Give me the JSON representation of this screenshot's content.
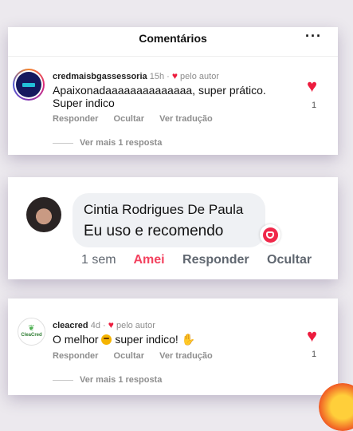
{
  "card1": {
    "title": "Comentários",
    "more_icon": "more-horizontal-icon",
    "username": "credmaisbgassessoria",
    "time": "15h",
    "separator": "·",
    "liked_by_author": "pelo autor",
    "text": "Apaixonadaaaaaaaaaaaaaa, super prático. Super indico",
    "actions": {
      "reply": "Responder",
      "hide": "Ocultar",
      "translate": "Ver tradução"
    },
    "like_count": "1",
    "view_replies": "Ver mais 1 resposta"
  },
  "card2": {
    "name": "Cintia Rodrigues De Paula",
    "text": "Eu uso e recomendo",
    "time": "1 sem",
    "love": "Amei",
    "reply": "Responder",
    "hide": "Ocultar"
  },
  "card3": {
    "username": "cleacred",
    "avatar_brand": "CleaCred",
    "time": "4d",
    "separator": "·",
    "liked_by_author": "pelo autor",
    "text_before": "O melhor",
    "text_after": "super indico!",
    "actions": {
      "reply": "Responder",
      "hide": "Ocultar",
      "translate": "Ver tradução"
    },
    "like_count": "1",
    "view_replies": "Ver mais 1 resposta"
  },
  "colors": {
    "accent_red": "#ed1c3e",
    "amei": "#f3425f",
    "muted": "#8e8e8e",
    "background": "#ece9ee"
  }
}
